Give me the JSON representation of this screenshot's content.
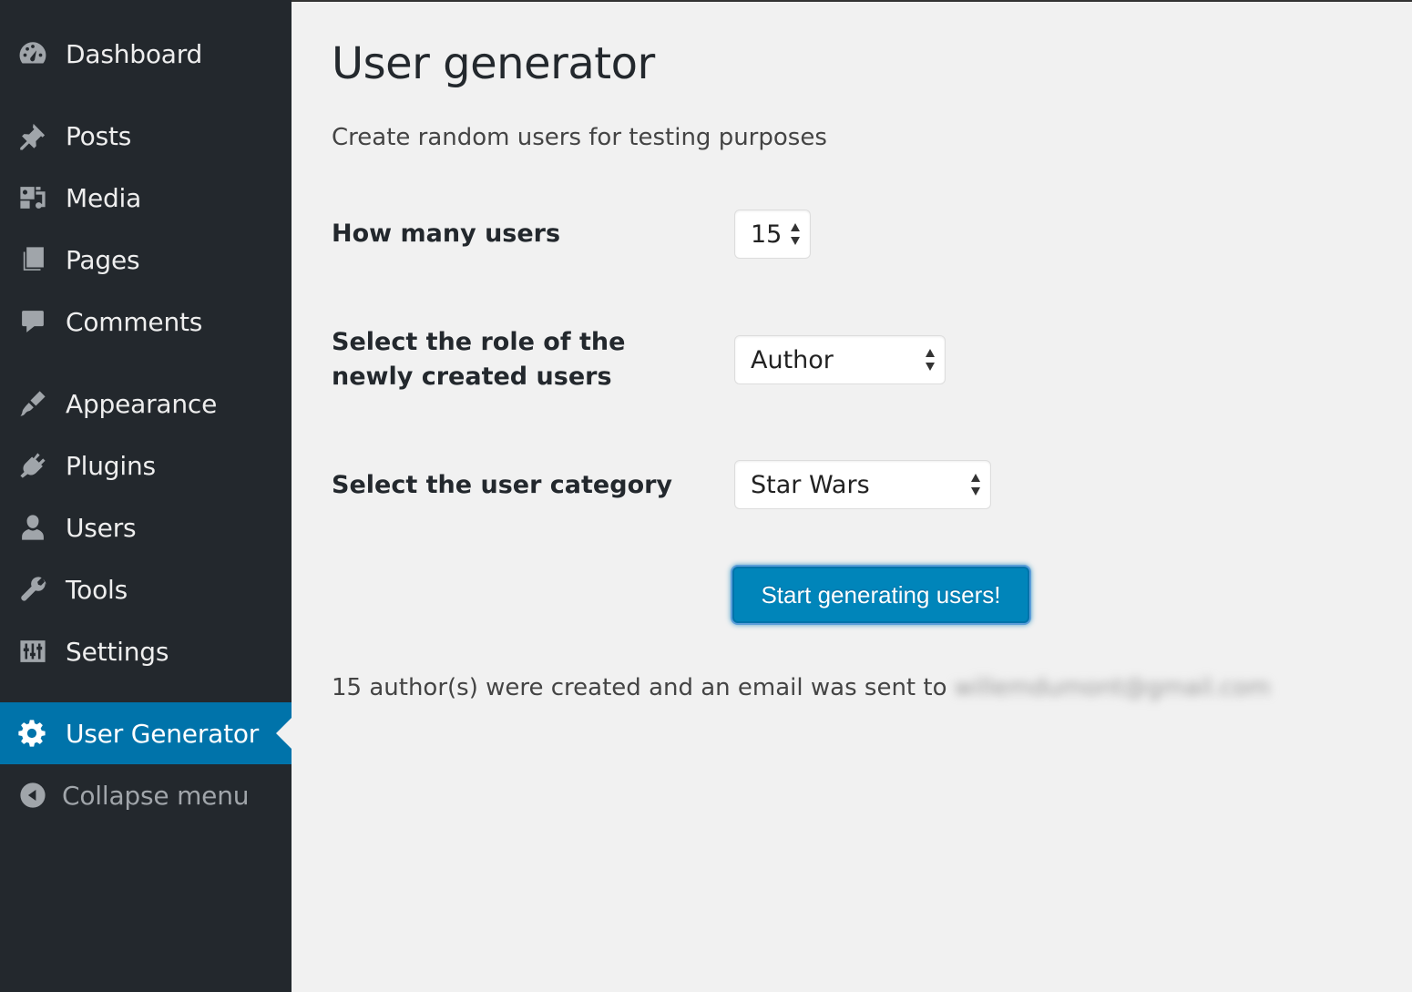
{
  "sidebar": {
    "items": [
      {
        "label": "Dashboard",
        "icon": "dashboard-icon"
      },
      {
        "label": "Posts",
        "icon": "pin-icon"
      },
      {
        "label": "Media",
        "icon": "media-icon"
      },
      {
        "label": "Pages",
        "icon": "pages-icon"
      },
      {
        "label": "Comments",
        "icon": "comment-icon"
      },
      {
        "label": "Appearance",
        "icon": "brush-icon"
      },
      {
        "label": "Plugins",
        "icon": "plugin-icon"
      },
      {
        "label": "Users",
        "icon": "user-icon"
      },
      {
        "label": "Tools",
        "icon": "wrench-icon"
      },
      {
        "label": "Settings",
        "icon": "sliders-icon"
      },
      {
        "label": "User Generator",
        "icon": "gear-icon",
        "active": true
      }
    ],
    "collapse_label": "Collapse menu",
    "colors": {
      "background": "#23282d",
      "active": "#0073aa",
      "icon": "#a0a5aa"
    }
  },
  "main": {
    "title": "User generator",
    "subtitle": "Create random users for testing purposes",
    "fields": {
      "user_count": {
        "label": "How many users",
        "value": "15"
      },
      "role": {
        "label": "Select the role of the newly created users",
        "value": "Author"
      },
      "category": {
        "label": "Select the user category",
        "value": "Star Wars"
      }
    },
    "submit_label": "Start generating users!",
    "result_message": "15 author(s) were created and an email was sent to",
    "result_email": "willemdumont@gmail.com",
    "colors": {
      "button": "#0085ba",
      "background": "#f1f1f1"
    }
  }
}
